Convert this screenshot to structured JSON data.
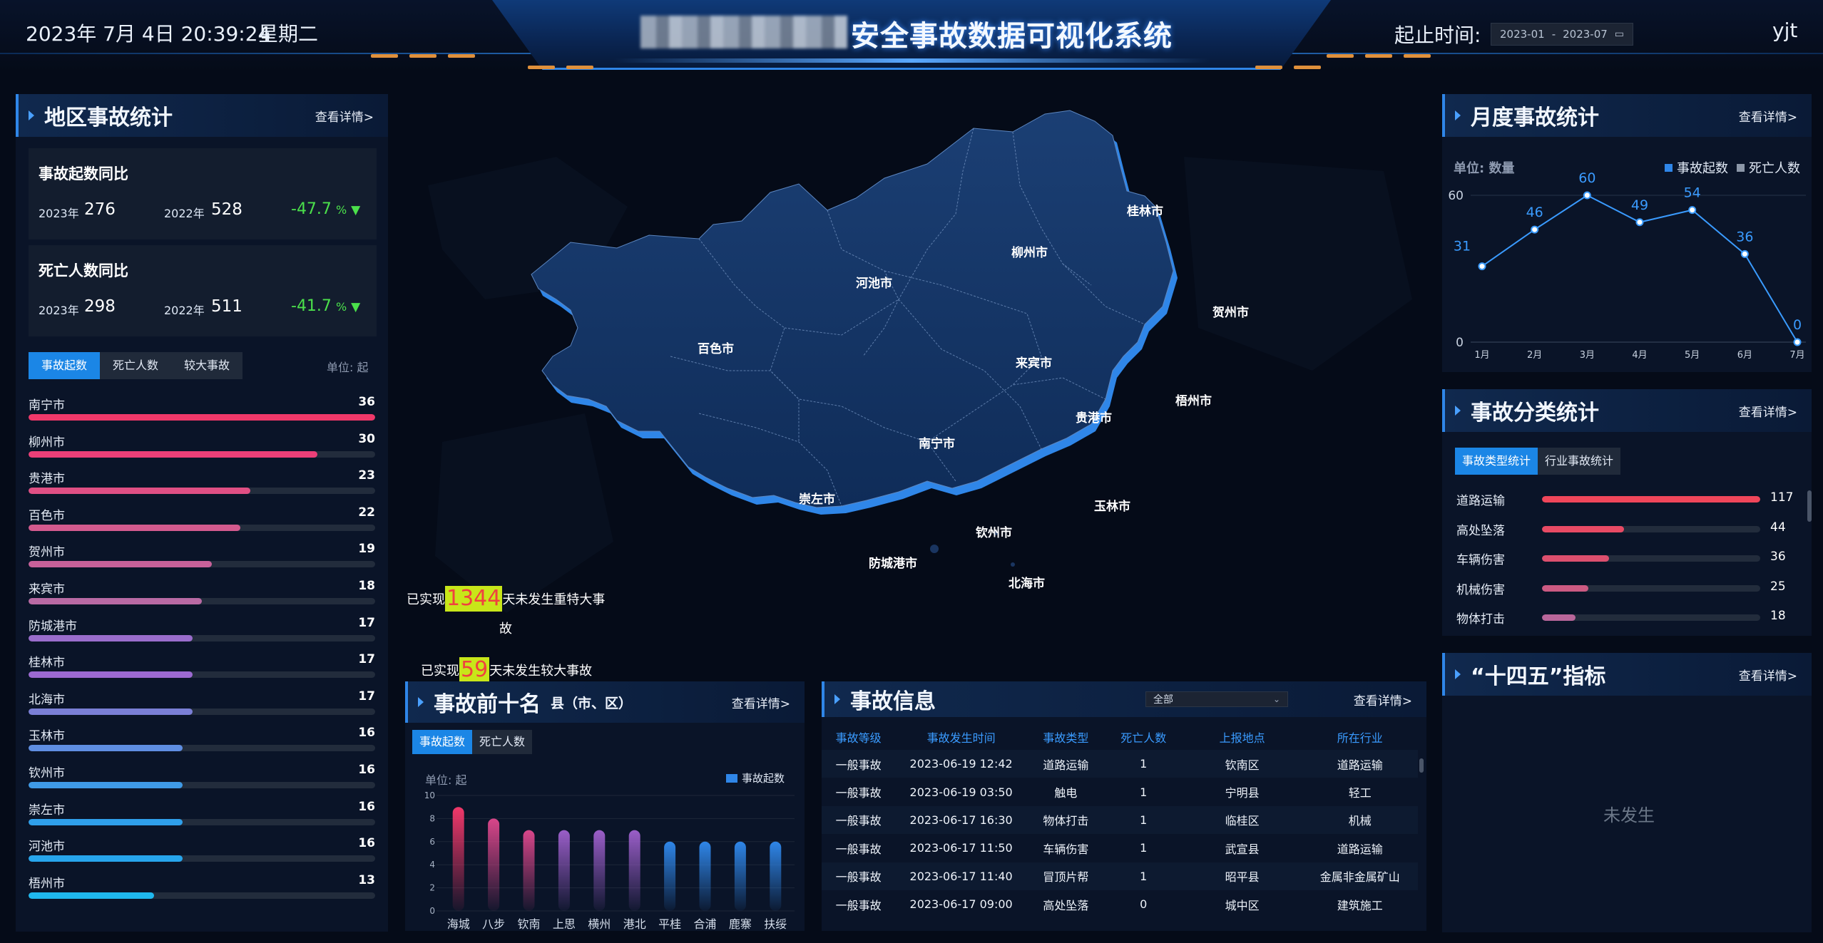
{
  "header": {
    "datetime": "2023年 7月 4日 20:39:24",
    "weekday": "星期二",
    "title": "安全事故数据可视化系统",
    "range_label": "起止时间:",
    "range_start": "2023-01",
    "range_sep": "-",
    "range_end": "2023-07",
    "calendar_icon": "calendar-icon",
    "user": "yjt"
  },
  "region": {
    "title": "地区事故统计",
    "more": "查看详情>",
    "accidents": {
      "title": "事故起数同比",
      "y1_label": "2023年",
      "y1": "276",
      "y2_label": "2022年",
      "y2": "528",
      "pct": "-47.7",
      "pct_unit": "%",
      "arrow": "▼"
    },
    "deaths": {
      "title": "死亡人数同比",
      "y1_label": "2023年",
      "y1": "298",
      "y2_label": "2022年",
      "y2": "511",
      "pct": "-41.7",
      "pct_unit": "%",
      "arrow": "▼"
    },
    "tabs": [
      "事故起数",
      "死亡人数",
      "较大事故"
    ],
    "unit": "单位: 起",
    "max": 36,
    "items": [
      {
        "name": "南宁市",
        "value": 36,
        "color": "#f0386a"
      },
      {
        "name": "柳州市",
        "value": 30,
        "color": "#ec3f78"
      },
      {
        "name": "贵港市",
        "value": 23,
        "color": "#e04f84"
      },
      {
        "name": "百色市",
        "value": 22,
        "color": "#d35a8e"
      },
      {
        "name": "贺州市",
        "value": 19,
        "color": "#c7619a"
      },
      {
        "name": "来宾市",
        "value": 18,
        "color": "#b96aa4"
      },
      {
        "name": "防城港市",
        "value": 17,
        "color": "#9a6dcc"
      },
      {
        "name": "桂林市",
        "value": 17,
        "color": "#9c6ad2"
      },
      {
        "name": "北海市",
        "value": 17,
        "color": "#7a7fd6"
      },
      {
        "name": "玉林市",
        "value": 16,
        "color": "#5f8ee2"
      },
      {
        "name": "钦州市",
        "value": 16,
        "color": "#3f9ae6"
      },
      {
        "name": "崇左市",
        "value": 16,
        "color": "#2f9fea"
      },
      {
        "name": "河池市",
        "value": 16,
        "color": "#27a5ec"
      },
      {
        "name": "梧州市",
        "value": 13,
        "color": "#1fb8ee"
      }
    ]
  },
  "map": {
    "cities": [
      "桂林市",
      "柳州市",
      "河池市",
      "贺州市",
      "百色市",
      "来宾市",
      "梧州市",
      "贵港市",
      "南宁市",
      "崇左市",
      "玉林市",
      "钦州市",
      "防城港市",
      "北海市"
    ],
    "notice1_pre": "已实现",
    "notice1_num": "1344",
    "notice1_post": "天未发生重特大事",
    "notice1_tail": "故",
    "notice2_pre": "已实现",
    "notice2_num": "59",
    "notice2_post": "天未发生较大事故"
  },
  "top10": {
    "title": "事故前十名",
    "subtitle": "县（市、区）",
    "more": "查看详情>",
    "tabs": [
      "事故起数",
      "死亡人数"
    ],
    "unit": "单位: 起",
    "legend": "事故起数"
  },
  "info": {
    "title": "事故信息",
    "filter": "全部",
    "more": "查看详情>",
    "columns": [
      "事故等级",
      "事故发生时间",
      "事故类型",
      "死亡人数",
      "上报地点",
      "所在行业"
    ],
    "rows": [
      [
        "一般事故",
        "2023-06-19 12:42",
        "道路运输",
        "1",
        "钦南区",
        "道路运输"
      ],
      [
        "一般事故",
        "2023-06-19 03:50",
        "触电",
        "1",
        "宁明县",
        "轻工"
      ],
      [
        "一般事故",
        "2023-06-17 16:30",
        "物体打击",
        "1",
        "临桂区",
        "机械"
      ],
      [
        "一般事故",
        "2023-06-17 11:50",
        "车辆伤害",
        "1",
        "武宣县",
        "道路运输"
      ],
      [
        "一般事故",
        "2023-06-17 11:40",
        "冒顶片帮",
        "1",
        "昭平县",
        "金属非金属矿山"
      ],
      [
        "一般事故",
        "2023-06-17 09:00",
        "高处坠落",
        "0",
        "城中区",
        "建筑施工"
      ]
    ]
  },
  "monthly": {
    "title": "月度事故统计",
    "more": "查看详情>",
    "unit": "单位:  数量",
    "legend": [
      "事故起数",
      "死亡人数"
    ]
  },
  "category": {
    "title": "事故分类统计",
    "more": "查看详情>",
    "tabs": [
      "事故类型统计",
      "行业事故统计"
    ],
    "max": 117,
    "items": [
      {
        "name": "道路运输",
        "value": 117,
        "color": "#f0465a"
      },
      {
        "name": "高处坠落",
        "value": 44,
        "color": "#e84a64"
      },
      {
        "name": "车辆伤害",
        "value": 36,
        "color": "#dc4f6e"
      },
      {
        "name": "机械伤害",
        "value": 25,
        "color": "#cc5a82"
      },
      {
        "name": "物体打击",
        "value": 18,
        "color": "#b9669a"
      }
    ]
  },
  "plan": {
    "title": "“十四五”指标",
    "more": "查看详情>",
    "empty": "未发生"
  },
  "chart_data": [
    {
      "type": "line",
      "title": "月度事故统计",
      "categories": [
        "1月",
        "2月",
        "3月",
        "4月",
        "5月",
        "6月",
        "7月"
      ],
      "series": [
        {
          "name": "事故起数",
          "values": [
            31,
            46,
            60,
            49,
            54,
            36,
            0
          ]
        }
      ],
      "ylim": [
        0,
        60
      ],
      "yticks": [
        "0",
        "60"
      ],
      "grid": true,
      "legend": "top-right"
    },
    {
      "type": "bar",
      "title": "事故前十名",
      "categories": [
        "海城",
        "八步",
        "钦南",
        "上思",
        "横州",
        "港北",
        "平桂",
        "合浦",
        "鹿寨",
        "扶绥"
      ],
      "series": [
        {
          "name": "事故起数",
          "values": [
            9,
            8,
            7,
            7,
            7,
            7,
            6,
            6,
            6,
            6
          ]
        }
      ],
      "ylim": [
        0,
        10
      ],
      "yticks": [
        "0",
        "2",
        "4",
        "6",
        "8",
        "10"
      ],
      "grid": true,
      "legend": "top-right"
    }
  ]
}
